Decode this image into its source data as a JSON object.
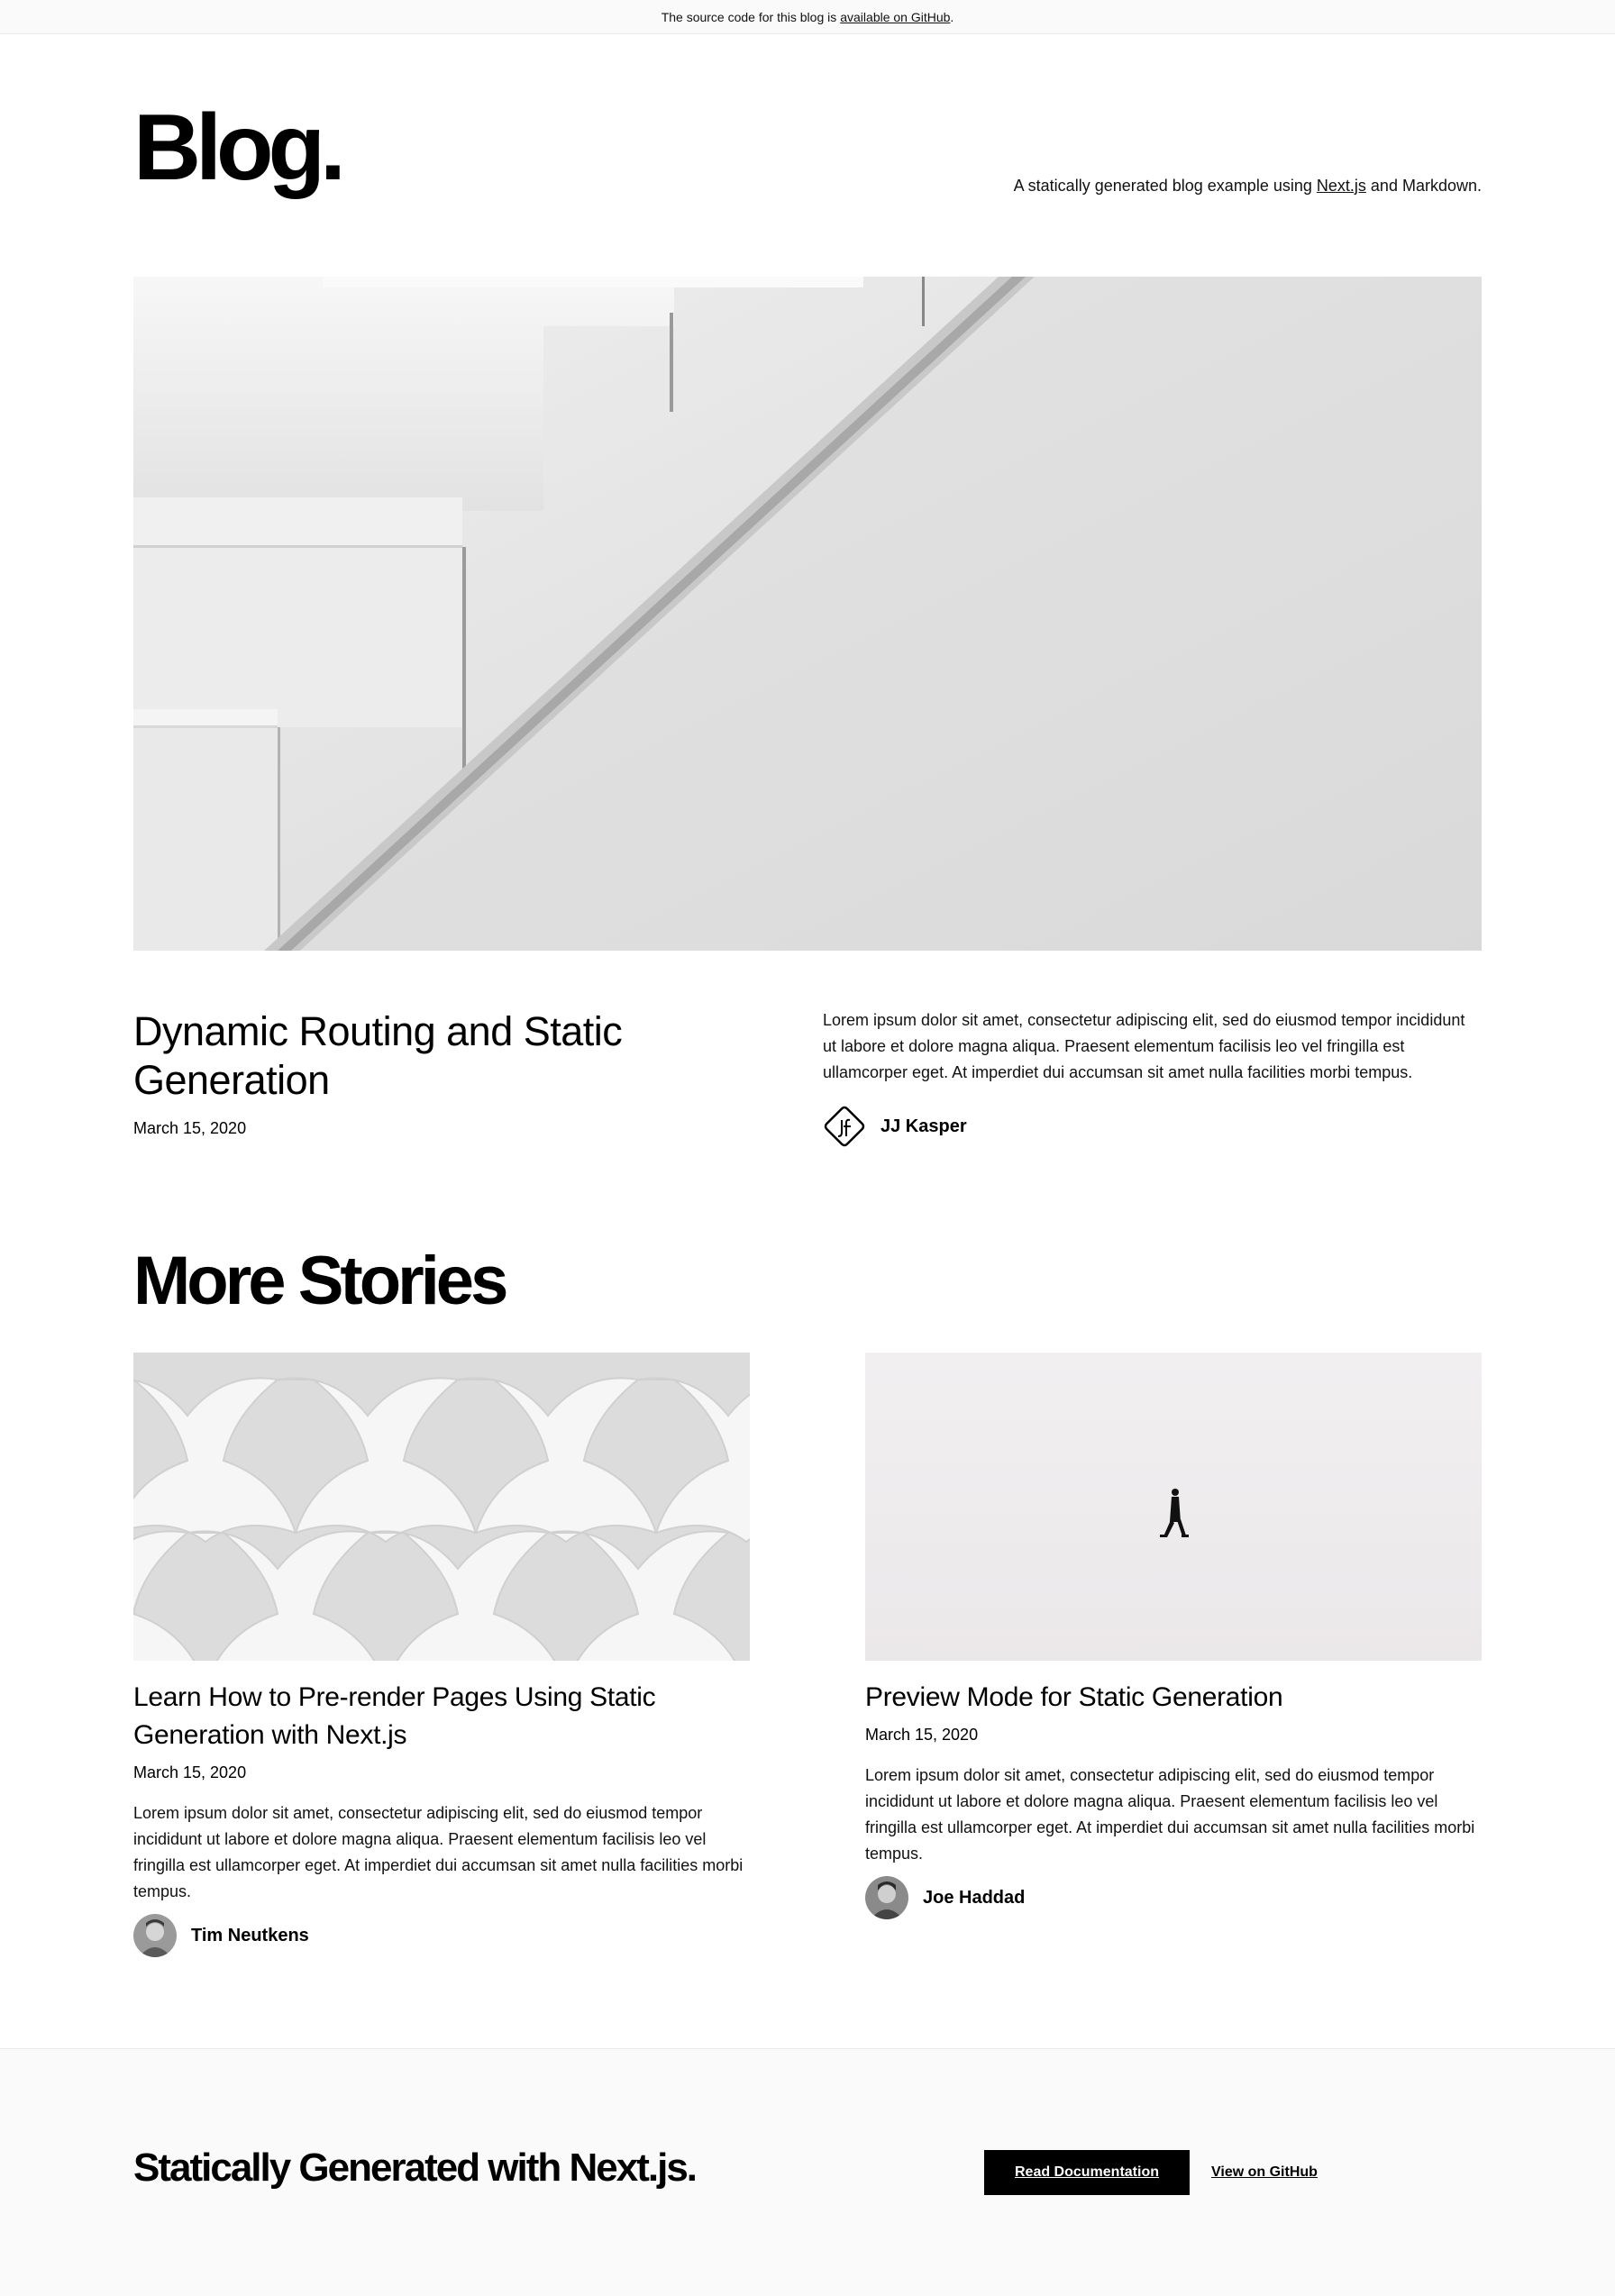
{
  "banner": {
    "text": "The source code for this blog is",
    "link_label": "available on GitHub",
    "suffix": "."
  },
  "header": {
    "logo": "Blog.",
    "tagline_prefix": "A statically generated blog example using",
    "tagline_link": "Next.js",
    "tagline_suffix": "and Markdown."
  },
  "hero": {
    "title": "Dynamic Routing and Static Generation",
    "date": "March 15, 2020",
    "excerpt": "Lorem ipsum dolor sit amet, consectetur adipiscing elit, sed do eiusmod tempor incididunt ut labore et dolore magna aliqua. Praesent elementum facilisis leo vel fringilla est ullamcorper eget. At imperdiet dui accumsan sit amet nulla facilities morbi tempus.",
    "author": "JJ Kasper"
  },
  "more_stories": {
    "heading": "More Stories",
    "posts": [
      {
        "title": "Learn How to Pre-render Pages Using Static Generation with Next.js",
        "date": "March 15, 2020",
        "excerpt": "Lorem ipsum dolor sit amet, consectetur adipiscing elit, sed do eiusmod tempor incididunt ut labore et dolore magna aliqua. Praesent elementum facilisis leo vel fringilla est ullamcorper eget. At imperdiet dui accumsan sit amet nulla facilities morbi tempus.",
        "author": "Tim Neutkens"
      },
      {
        "title": "Preview Mode for Static Generation",
        "date": "March 15, 2020",
        "excerpt": "Lorem ipsum dolor sit amet, consectetur adipiscing elit, sed do eiusmod tempor incididunt ut labore et dolore magna aliqua. Praesent elementum facilisis leo vel fringilla est ullamcorper eget. At imperdiet dui accumsan sit amet nulla facilities morbi tempus.",
        "author": "Joe Haddad"
      }
    ]
  },
  "footer": {
    "title": "Statically Generated with Next.js.",
    "primary_button": "Read Documentation",
    "secondary_link": "View on GitHub"
  },
  "colors": {
    "text": "#000000",
    "background": "#ffffff",
    "banner_bg": "#fafafa",
    "footer_bg": "#fafafa",
    "button_bg": "#000000",
    "button_text": "#ffffff"
  }
}
